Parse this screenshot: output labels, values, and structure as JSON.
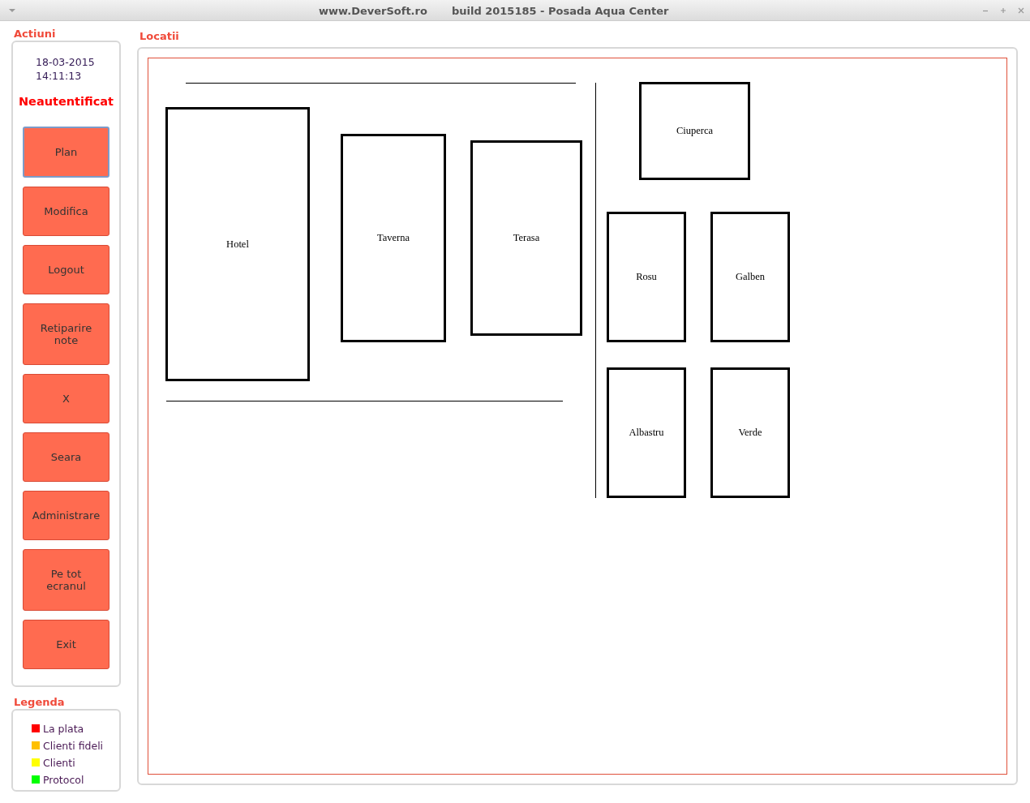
{
  "window": {
    "site": "www.DeverSoft.ro",
    "title": "build 2015185 - Posada Aqua Center"
  },
  "actions": {
    "title": "Actiuni",
    "date": "18-03-2015",
    "time": "14:11:13",
    "status": "Neautentificat",
    "buttons": [
      {
        "label": "Plan",
        "selected": true
      },
      {
        "label": "Modifica",
        "selected": false
      },
      {
        "label": "Logout",
        "selected": false
      },
      {
        "label": "Retiparire note",
        "selected": false
      },
      {
        "label": "X",
        "selected": false
      },
      {
        "label": "Seara",
        "selected": false
      },
      {
        "label": "Administrare",
        "selected": false
      },
      {
        "label": "Pe tot ecranul",
        "selected": false
      },
      {
        "label": "Exit",
        "selected": false
      }
    ]
  },
  "legend": {
    "title": "Legenda",
    "items": [
      {
        "label": "La plata",
        "color": "#ff0000"
      },
      {
        "label": "Clienti fideli",
        "color": "#ffc000"
      },
      {
        "label": "Clienti",
        "color": "#ffff00"
      },
      {
        "label": "Protocol",
        "color": "#00ff00"
      }
    ]
  },
  "locations": {
    "title": "Locatii",
    "items": [
      {
        "name": "Hotel"
      },
      {
        "name": "Taverna"
      },
      {
        "name": "Terasa"
      },
      {
        "name": "Ciuperca"
      },
      {
        "name": "Rosu"
      },
      {
        "name": "Galben"
      },
      {
        "name": "Albastru"
      },
      {
        "name": "Verde"
      }
    ]
  }
}
